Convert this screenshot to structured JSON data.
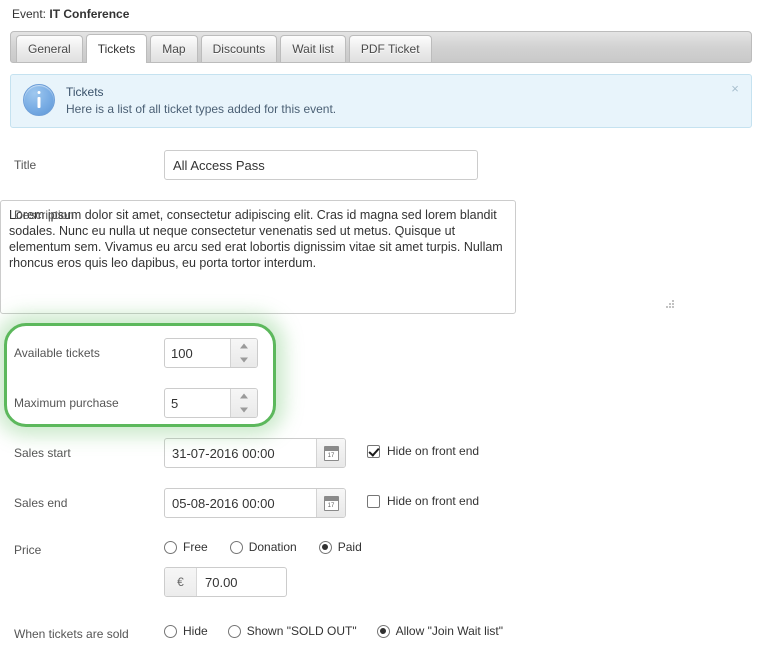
{
  "header": {
    "label": "Event:",
    "event_name": "IT Conference"
  },
  "tabs": [
    {
      "label": "General",
      "active": false
    },
    {
      "label": "Tickets",
      "active": true
    },
    {
      "label": "Map",
      "active": false
    },
    {
      "label": "Discounts",
      "active": false
    },
    {
      "label": "Wait list",
      "active": false
    },
    {
      "label": "PDF Ticket",
      "active": false
    }
  ],
  "alert": {
    "icon": "info-icon",
    "title": "Tickets",
    "body": "Here is a list of all ticket types added for this event.",
    "close_label": "×",
    "bg_color": "#e8f4fb",
    "border_color": "#c5e2f0",
    "icon_color": "#78ace4"
  },
  "form": {
    "title": {
      "label": "Title",
      "value": "All Access Pass",
      "placeholder": ""
    },
    "description": {
      "label": "Description",
      "value": "Lorem ipsum dolor sit amet, consectetur adipiscing elit. Cras id magna sed lorem blandit sodales. Nunc eu nulla ut neque consectetur venenatis sed ut metus. Quisque ut elementum sem. Vivamus eu arcu sed erat lobortis dignissim vitae sit amet turpis. Nullam rhoncus eros quis leo dapibus, eu porta tortor interdum.",
      "placeholder": ""
    },
    "available_tickets": {
      "label": "Available tickets",
      "value": "100"
    },
    "maximum_purchase": {
      "label": "Maximum purchase",
      "value": "5"
    },
    "sales_start": {
      "label": "Sales start",
      "value": "31-07-2016 00:00",
      "calendar_day": "17",
      "hide_label": "Hide on front end",
      "hide_checked": true
    },
    "sales_end": {
      "label": "Sales end",
      "value": "05-08-2016 00:00",
      "calendar_day": "17",
      "hide_label": "Hide on front end",
      "hide_checked": false
    },
    "price": {
      "label": "Price",
      "options": [
        {
          "label": "Free",
          "selected": false
        },
        {
          "label": "Donation",
          "selected": false
        },
        {
          "label": "Paid",
          "selected": true
        }
      ],
      "currency": "€",
      "amount": "70.00"
    },
    "when_sold": {
      "label": "When tickets are sold",
      "options": [
        {
          "label": "Hide",
          "selected": false
        },
        {
          "label": "Shown \"SOLD OUT\"",
          "selected": false
        },
        {
          "label": "Allow \"Join Wait list\"",
          "selected": true
        }
      ]
    }
  },
  "highlight": {
    "color": "#5cb85c",
    "glow": "rgba(120,200,120,0.38)"
  }
}
